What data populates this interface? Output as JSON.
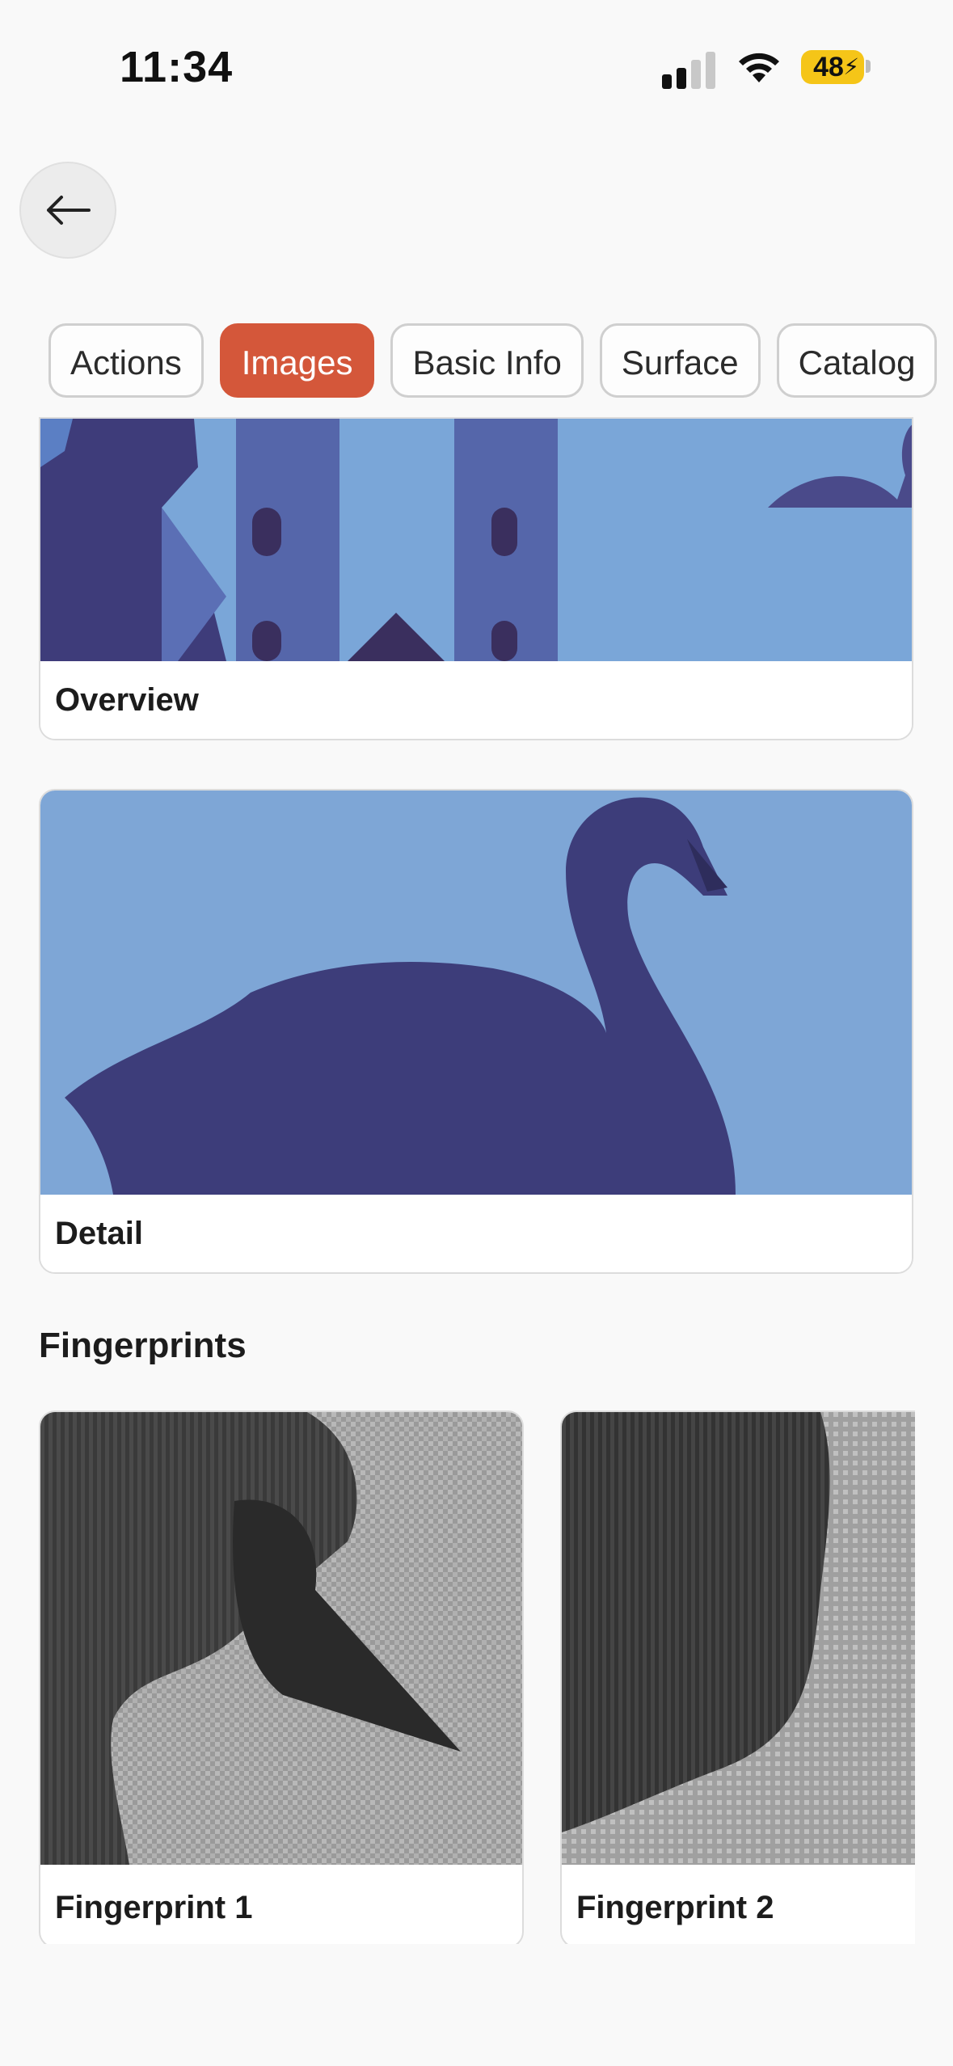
{
  "status_bar": {
    "time": "11:34",
    "battery": "48"
  },
  "tabs": [
    {
      "label": "Actions",
      "active": false
    },
    {
      "label": "Images",
      "active": true
    },
    {
      "label": "Basic Info",
      "active": false
    },
    {
      "label": "Surface",
      "active": false
    },
    {
      "label": "Catalog",
      "active": false
    }
  ],
  "images": {
    "overview_caption": "Overview",
    "detail_caption": "Detail"
  },
  "fingerprints": {
    "title": "Fingerprints",
    "items": [
      {
        "caption": "Fingerprint 1"
      },
      {
        "caption": "Fingerprint 2"
      }
    ]
  },
  "colors": {
    "accent": "#d4573a",
    "sky_blue": "#7aa6d8",
    "silhouette": "#3d3d7a"
  }
}
